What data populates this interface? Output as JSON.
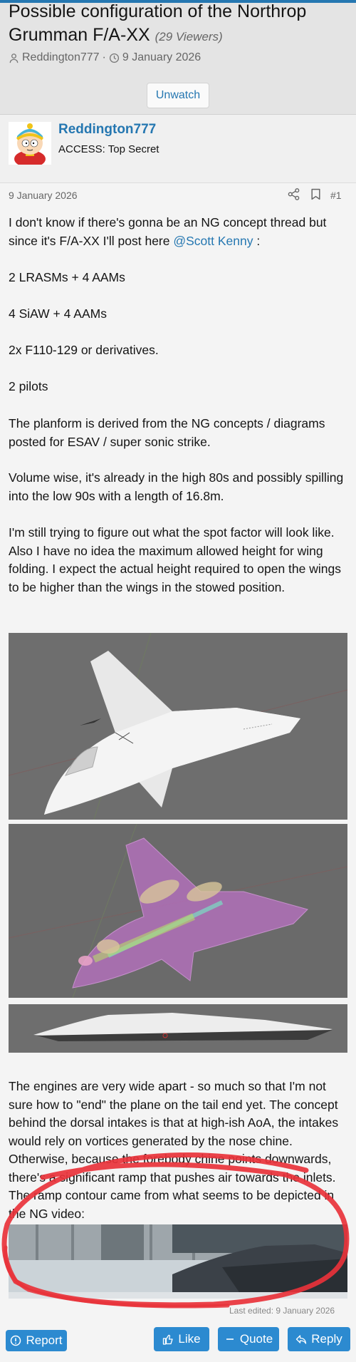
{
  "thread": {
    "title": "Possible configuration of the Northrop Grumman F/A-XX",
    "viewers": "(29 Viewers)",
    "author": "Reddington777",
    "date": "9 January 2026",
    "watch_label": "Unwatch"
  },
  "user": {
    "name": "Reddington777",
    "title": "ACCESS: Top Secret"
  },
  "post": {
    "date": "9 January 2026",
    "number": "#1",
    "intro_before": "I don't know if there's gonna be an NG concept thread but since it's F/A-XX I'll post here ",
    "mention": "@Scott Kenny",
    "intro_after": " :",
    "line1": "2 LRASMs + 4 AAMs",
    "line2": "4 SiAW + 4 AAMs",
    "line3": "2x F110-129 or derivatives.",
    "line4": "2 pilots",
    "para1": "The planform is derived from the NG concepts / diagrams posted for ESAV / super sonic strike.",
    "para2": "Volume wise, it's already in the high 80s and possibly spilling into the low 90s with a length of 16.8m.",
    "para3": "I'm still trying to figure out what the spot factor will look like. Also I have no idea the maximum allowed height for wing folding. I expect the actual height required to open the wings to be higher than the wings in the stowed position.",
    "para4": "The engines are very wide apart - so much so that I'm not sure how to \"end\" the plane on the tail end yet. The concept behind the dorsal intakes is that at high-ish AoA, the intakes would rely on vortices generated by the nose chine. Otherwise, because the forebody chine points downwards, there's a significant ramp that pushes air towards the inlets. The ramp contour came from what seems to be depicted in the NG video:",
    "last_edited": "Last edited: 9 January 2026"
  },
  "actions": {
    "report": "Report",
    "like": "Like",
    "quote": "Quote",
    "reply": "Reply"
  },
  "colors": {
    "accent": "#2577b1",
    "button": "#2c8ad0",
    "annotation": "#e8323a"
  }
}
